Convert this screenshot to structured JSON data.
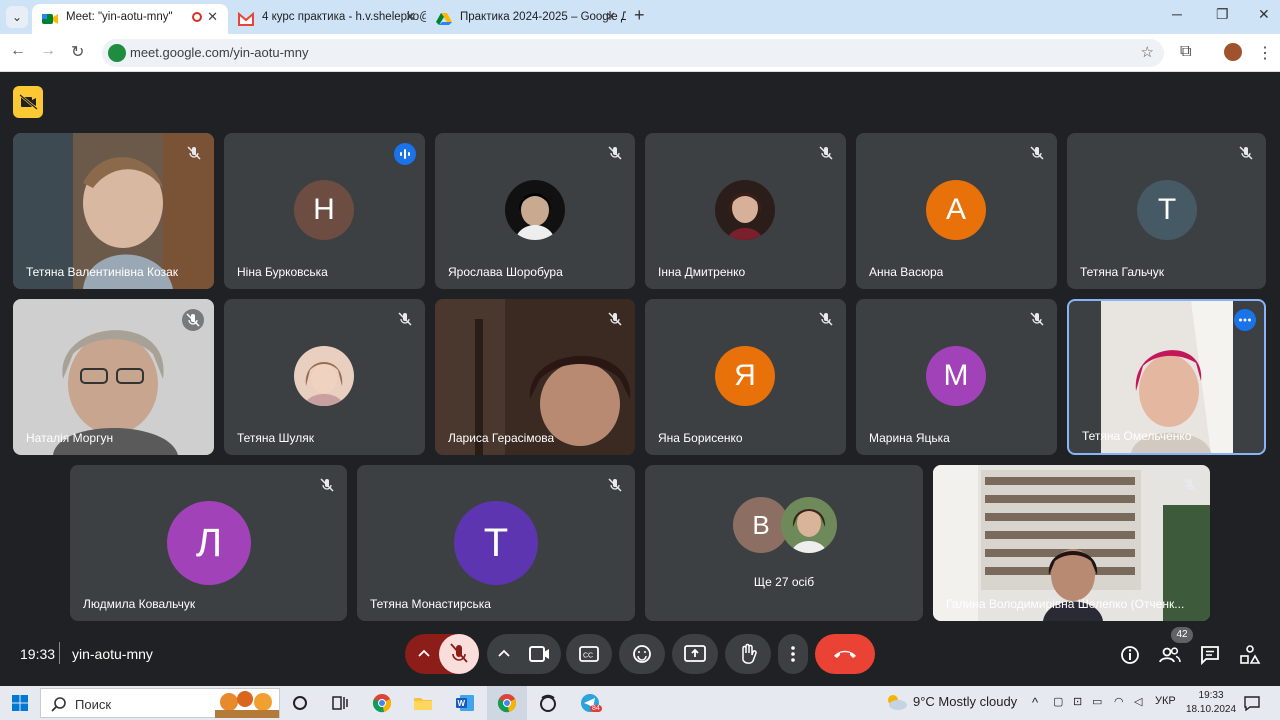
{
  "browser": {
    "tabs": [
      {
        "title": "Meet: \"yin-aotu-mny\"",
        "active": true
      },
      {
        "title": "4 курс практика - h.v.shelepko@",
        "active": false
      },
      {
        "title": "Практика 2024-2025 – Google Д",
        "active": false
      }
    ],
    "new_tab": "+",
    "url": "meet.google.com/yin-aotu-mny"
  },
  "participants": [
    {
      "name": "Тетяна Валентинівна Козак",
      "kind": "video"
    },
    {
      "name": "Ніна Бурковська",
      "kind": "letter",
      "letter": "Н",
      "color": "#6d4c41",
      "speaking": true
    },
    {
      "name": "Ярослава Шоробура",
      "kind": "photo"
    },
    {
      "name": "Інна Дмитренко",
      "kind": "photo"
    },
    {
      "name": "Анна Васюра",
      "kind": "letter",
      "letter": "А",
      "color": "#e8710a"
    },
    {
      "name": "Тетяна Гальчук",
      "kind": "letter",
      "letter": "Т",
      "color": "#455a64"
    },
    {
      "name": "Наталія Моргун",
      "kind": "video"
    },
    {
      "name": "Тетяна Шуляк",
      "kind": "photo"
    },
    {
      "name": "Лариса Герасімова",
      "kind": "video"
    },
    {
      "name": "Яна Борисенко",
      "kind": "letter",
      "letter": "Я",
      "color": "#e8710a"
    },
    {
      "name": "Марина Яцька",
      "kind": "letter",
      "letter": "М",
      "color": "#a142b8"
    },
    {
      "name": "Тетяна Омельченко",
      "kind": "video",
      "highlighted": true
    },
    {
      "name": "Людмила Ковальчук",
      "kind": "letter",
      "letter": "Л",
      "color": "#a142b8"
    },
    {
      "name": "Тетяна Монастирська",
      "kind": "letter",
      "letter": "Т",
      "color": "#5e35b1"
    },
    {
      "name": "Галина Володимирівна Шелепко (Отченк...",
      "kind": "video"
    }
  ],
  "others_tile": {
    "label": "Ще 27 осіб",
    "letter": "В",
    "color": "#8d6e63"
  },
  "bottom_bar": {
    "time": "19:33",
    "meeting_code": "yin-aotu-mny",
    "participants_count": "42"
  },
  "taskbar": {
    "search_label": "Поиск",
    "telegram_badge": "84",
    "weather": "9°C  Mostly cloudy",
    "lang": "УКР",
    "clock_time": "19:33",
    "clock_date": "18.10.2024"
  }
}
